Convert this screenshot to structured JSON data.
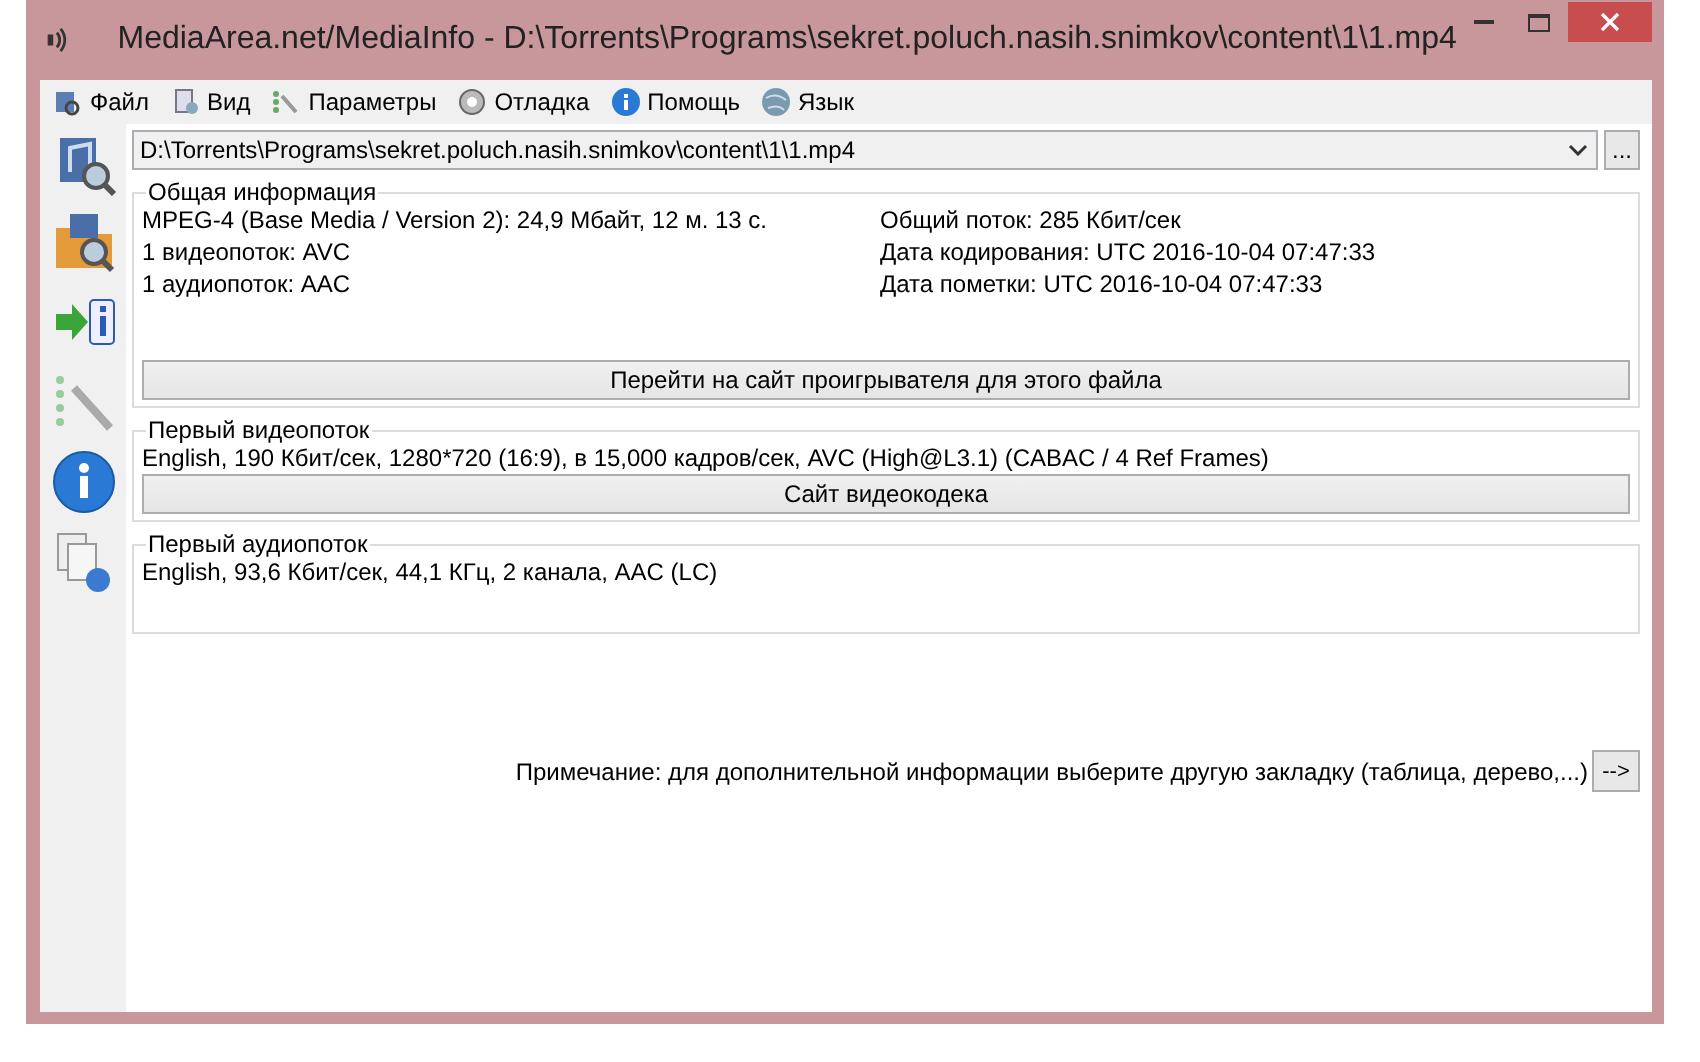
{
  "window": {
    "title": "MediaArea.net/MediaInfo - D:\\Torrents\\Programs\\sekret.poluch.nasih.snimkov\\content\\1\\1.mp4"
  },
  "menu": [
    {
      "label": "Файл",
      "kind": "file"
    },
    {
      "label": "Вид",
      "kind": "view"
    },
    {
      "label": "Параметры",
      "kind": "options"
    },
    {
      "label": "Отладка",
      "kind": "debug"
    },
    {
      "label": "Помощь",
      "kind": "help"
    },
    {
      "label": "Язык",
      "kind": "language"
    }
  ],
  "file_combo": {
    "value": "D:\\Torrents\\Programs\\sekret.poluch.nasih.snimkov\\content\\1\\1.mp4",
    "browse_button": "..."
  },
  "general": {
    "title": "Общая информация",
    "left": [
      "MPEG-4 (Base Media / Version 2): 24,9 Мбайт, 12 м. 13 с.",
      "1 видеопоток: AVC",
      "1 аудиопоток: AAC"
    ],
    "right": [
      "Общий поток: 285 Кбит/сек",
      "Дата кодирования: UTC 2016-10-04 07:47:33",
      "Дата пометки: UTC 2016-10-04 07:47:33"
    ],
    "button": "Перейти на сайт проигрывателя для этого файла"
  },
  "video": {
    "title": "Первый видеопоток",
    "lines": [
      "English, 190 Кбит/сек, 1280*720 (16:9), в 15,000 кадров/сек, AVC (High@L3.1) (CABAC / 4 Ref Frames)"
    ],
    "button": "Сайт видеокодека"
  },
  "audio": {
    "title": "Первый аудиопоток",
    "lines": [
      "English, 93,6 Кбит/сек, 44,1 КГц, 2 канала, AAC (LC)"
    ]
  },
  "note": {
    "text": "Примечание: для дополнительной информации выберите другую закладку (таблица, дерево,...)",
    "button": "-->"
  }
}
